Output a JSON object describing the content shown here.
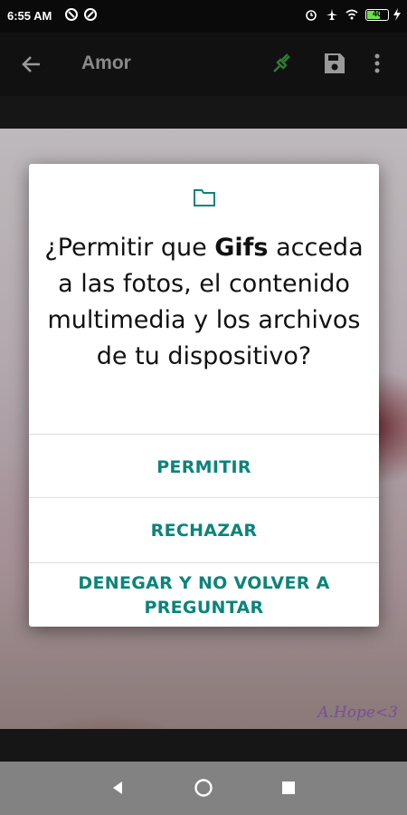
{
  "status_bar": {
    "time": "6:55 AM",
    "icons": [
      "notification-icon",
      "notification-icon",
      "alarm-icon",
      "airplane-icon",
      "wifi-icon",
      "battery-icon",
      "charging-icon"
    ],
    "battery_level": "40"
  },
  "app_bar": {
    "title": "Amor",
    "icons": [
      "back-arrow-icon",
      "wallpaper-icon",
      "save-icon",
      "more-vert-icon"
    ]
  },
  "gif": {
    "watermark": "A.Hope<3"
  },
  "dialog": {
    "icon": "folder-icon",
    "message_prefix": "¿Permitir que ",
    "app_name": "Gifs",
    "message_suffix": " acceda a las fotos, el contenido multimedia y los archivos de tu dispositivo?",
    "allow_label": "PERMITIR",
    "deny_label": "RECHAZAR",
    "deny_forever_label": "DENEGAR Y NO VOLVER A PREGUNTAR",
    "accent_color": "#0b8479"
  },
  "nav_bar": {
    "icons": [
      "back-icon",
      "home-icon",
      "recents-icon"
    ]
  }
}
